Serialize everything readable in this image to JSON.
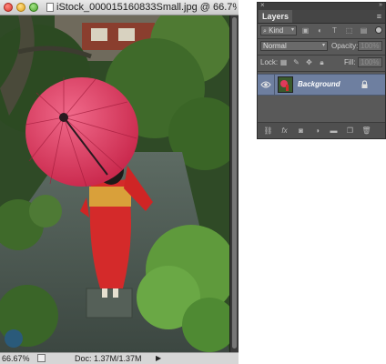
{
  "document": {
    "title": "iStock_000015160833Small.jpg @ 66.7% (R...",
    "zoom": "66.67%",
    "doc_size": "Doc: 1.37M/1.37M"
  },
  "layers_panel": {
    "tab": "Layers",
    "filter_kind": "Kind",
    "blend_mode": "Normal",
    "opacity_label": "Opacity:",
    "opacity_value": "100%",
    "lock_label": "Lock:",
    "fill_label": "Fill:",
    "fill_value": "100%",
    "layers": [
      {
        "name": "Background",
        "visible": true,
        "locked": true,
        "selected": true
      }
    ],
    "footer_icons": [
      "link-icon",
      "fx-icon",
      "add-mask-icon",
      "adjustment-layer-icon",
      "new-group-icon",
      "new-layer-icon",
      "trash-icon"
    ]
  },
  "colors": {
    "panel_bg": "#595959",
    "selected_layer": "#6e7fa0",
    "umbrella": "#e03a5c",
    "kimono": "#d42a2a"
  }
}
